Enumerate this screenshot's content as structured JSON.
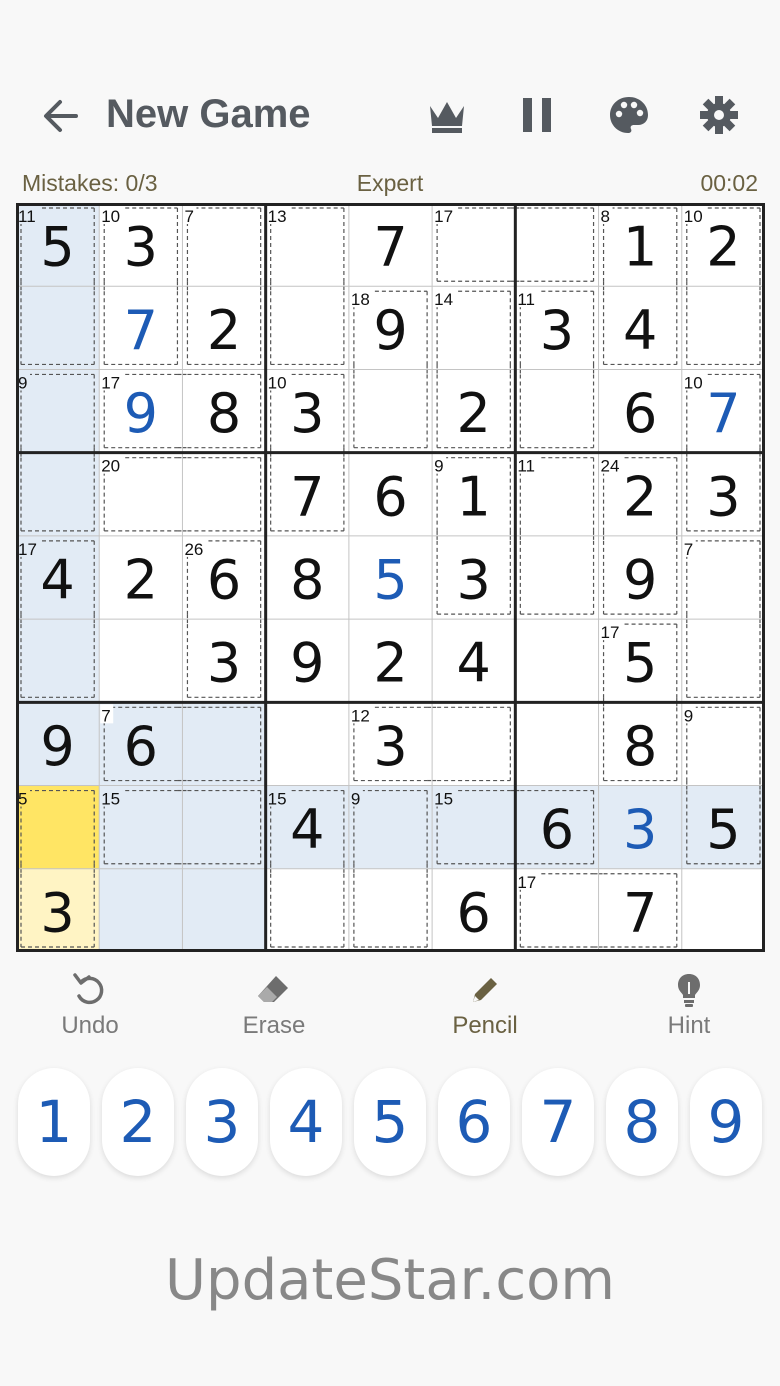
{
  "header": {
    "title": "New Game",
    "icons": [
      "back-arrow-icon",
      "crown-icon",
      "pause-icon",
      "palette-icon",
      "gear-icon"
    ]
  },
  "status": {
    "mistakes": "Mistakes: 0/3",
    "difficulty": "Expert",
    "timer": "00:02"
  },
  "colors": {
    "given": "#111111",
    "entered": "#1d5bb5",
    "highlight": "#e2ebf5",
    "selected": "#ffe564",
    "selected_light": "#fff4c4",
    "grid_thick": "#222222",
    "grid_thin": "#c4c4c4",
    "accent": "#6a6142"
  },
  "board": {
    "selected": [
      7,
      0
    ],
    "grid": [
      [
        5,
        3,
        0,
        0,
        7,
        0,
        0,
        1,
        2
      ],
      [
        0,
        7,
        2,
        0,
        9,
        0,
        3,
        4,
        0
      ],
      [
        0,
        9,
        8,
        3,
        0,
        2,
        0,
        6,
        7
      ],
      [
        0,
        0,
        0,
        7,
        6,
        1,
        0,
        2,
        3
      ],
      [
        4,
        2,
        6,
        8,
        5,
        3,
        0,
        9,
        0
      ],
      [
        0,
        0,
        3,
        9,
        2,
        4,
        0,
        5,
        0
      ],
      [
        9,
        6,
        0,
        0,
        3,
        0,
        0,
        8,
        0
      ],
      [
        0,
        0,
        0,
        4,
        0,
        0,
        6,
        3,
        5
      ],
      [
        3,
        0,
        0,
        0,
        0,
        6,
        0,
        7,
        0
      ]
    ],
    "entered": [
      [
        0,
        0,
        0,
        0,
        0,
        0,
        0,
        0,
        0
      ],
      [
        0,
        1,
        0,
        0,
        0,
        0,
        0,
        0,
        0
      ],
      [
        0,
        1,
        0,
        0,
        0,
        0,
        0,
        0,
        1
      ],
      [
        0,
        0,
        0,
        0,
        0,
        0,
        0,
        0,
        0
      ],
      [
        0,
        0,
        0,
        0,
        1,
        0,
        0,
        0,
        0
      ],
      [
        0,
        0,
        0,
        0,
        0,
        0,
        0,
        0,
        0
      ],
      [
        0,
        0,
        0,
        0,
        0,
        0,
        0,
        0,
        0
      ],
      [
        0,
        0,
        0,
        0,
        0,
        0,
        0,
        1,
        0
      ],
      [
        0,
        0,
        0,
        0,
        0,
        0,
        0,
        0,
        0
      ]
    ],
    "cages": [
      {
        "sum": 11,
        "cells": [
          [
            0,
            0
          ],
          [
            1,
            0
          ]
        ]
      },
      {
        "sum": 10,
        "cells": [
          [
            0,
            1
          ],
          [
            1,
            1
          ]
        ]
      },
      {
        "sum": 7,
        "cells": [
          [
            0,
            2
          ],
          [
            1,
            2
          ]
        ]
      },
      {
        "sum": 13,
        "cells": [
          [
            0,
            3
          ],
          [
            1,
            3
          ]
        ]
      },
      {
        "sum": 17,
        "cells": [
          [
            0,
            5
          ],
          [
            0,
            6
          ]
        ]
      },
      {
        "sum": 8,
        "cells": [
          [
            0,
            7
          ],
          [
            1,
            7
          ]
        ]
      },
      {
        "sum": 10,
        "cells": [
          [
            0,
            8
          ],
          [
            1,
            8
          ]
        ]
      },
      {
        "sum": 18,
        "cells": [
          [
            1,
            4
          ],
          [
            2,
            4
          ]
        ]
      },
      {
        "sum": 9,
        "cells": [
          [
            2,
            0
          ],
          [
            3,
            0
          ]
        ]
      },
      {
        "sum": 17,
        "cells": [
          [
            2,
            1
          ],
          [
            2,
            2
          ]
        ]
      },
      {
        "sum": 10,
        "cells": [
          [
            2,
            3
          ],
          [
            3,
            3
          ]
        ]
      },
      {
        "sum": 14,
        "cells": [
          [
            2,
            5
          ],
          [
            1,
            5
          ]
        ]
      },
      {
        "sum": 11,
        "cells": [
          [
            2,
            6
          ],
          [
            1,
            6
          ]
        ]
      },
      {
        "sum": 10,
        "cells": [
          [
            2,
            8
          ],
          [
            3,
            8
          ]
        ]
      },
      {
        "sum": 20,
        "cells": [
          [
            3,
            1
          ],
          [
            3,
            2
          ]
        ]
      },
      {
        "sum": 11,
        "cells": [
          [
            3,
            6
          ],
          [
            4,
            6
          ]
        ]
      },
      {
        "sum": 24,
        "cells": [
          [
            3,
            7
          ],
          [
            4,
            7
          ]
        ]
      },
      {
        "sum": 26,
        "cells": [
          [
            4,
            2
          ],
          [
            5,
            2
          ]
        ]
      },
      {
        "sum": 9,
        "cells": [
          [
            4,
            5
          ],
          [
            3,
            5
          ]
        ]
      },
      {
        "sum": 7,
        "cells": [
          [
            4,
            8
          ],
          [
            5,
            8
          ]
        ]
      },
      {
        "sum": 17,
        "cells": [
          [
            5,
            0
          ],
          [
            4,
            0
          ]
        ]
      },
      {
        "sum": 12,
        "cells": [
          [
            6,
            4
          ],
          [
            6,
            5
          ]
        ]
      },
      {
        "sum": 7,
        "cells": [
          [
            6,
            1
          ],
          [
            6,
            2
          ]
        ]
      },
      {
        "sum": 17,
        "cells": [
          [
            6,
            7
          ],
          [
            5,
            7
          ]
        ]
      },
      {
        "sum": 9,
        "cells": [
          [
            6,
            8
          ],
          [
            7,
            8
          ]
        ]
      },
      {
        "sum": 5,
        "cells": [
          [
            7,
            0
          ],
          [
            8,
            0
          ]
        ]
      },
      {
        "sum": 15,
        "cells": [
          [
            7,
            1
          ],
          [
            7,
            2
          ]
        ]
      },
      {
        "sum": 15,
        "cells": [
          [
            7,
            3
          ],
          [
            8,
            3
          ]
        ]
      },
      {
        "sum": 9,
        "cells": [
          [
            7,
            4
          ],
          [
            8,
            4
          ]
        ]
      },
      {
        "sum": 15,
        "cells": [
          [
            7,
            5
          ],
          [
            7,
            6
          ]
        ]
      },
      {
        "sum": 17,
        "cells": [
          [
            8,
            6
          ],
          [
            8,
            7
          ]
        ]
      }
    ]
  },
  "toolbar": {
    "undo": "Undo",
    "erase": "Erase",
    "pencil": "Pencil",
    "hint": "Hint"
  },
  "numpad": [
    "1",
    "2",
    "3",
    "4",
    "5",
    "6",
    "7",
    "8",
    "9"
  ],
  "footer": "UpdateStar.com"
}
